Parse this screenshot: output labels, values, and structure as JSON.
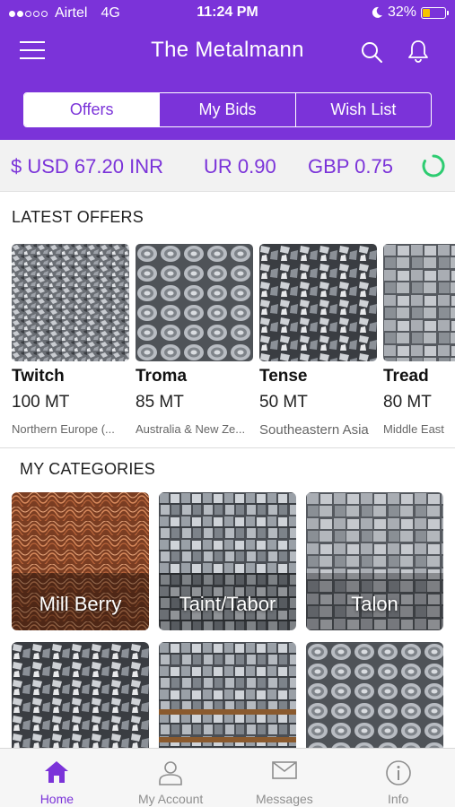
{
  "status_bar": {
    "carrier": "Airtel",
    "network": "4G",
    "time": "11:24 PM",
    "battery": "32%"
  },
  "header": {
    "title": "The Metalmann"
  },
  "tabs": [
    {
      "label": "Offers",
      "active": true
    },
    {
      "label": "My Bids",
      "active": false
    },
    {
      "label": "Wish List",
      "active": false
    }
  ],
  "ticker": [
    {
      "text": "$ USD 67.20 INR"
    },
    {
      "text": "UR 0.90"
    },
    {
      "text": "GBP 0.75"
    }
  ],
  "latest_offers": {
    "title": "LATEST OFFERS",
    "items": [
      {
        "name": "Twitch",
        "quantity": "100 MT",
        "region": "Northern Europe (..."
      },
      {
        "name": "Troma",
        "quantity": "85 MT",
        "region": "Australia & New Ze..."
      },
      {
        "name": "Tense",
        "quantity": "50 MT",
        "region": "Southeastern Asia"
      },
      {
        "name": "Tread",
        "quantity": "80 MT",
        "region": "Middle East"
      }
    ]
  },
  "my_categories": {
    "title": "MY CATEGORIES",
    "items": [
      {
        "label": "Mill Berry"
      },
      {
        "label": "Taint/Tabor"
      },
      {
        "label": "Talon"
      }
    ]
  },
  "tab_bar": [
    {
      "label": "Home",
      "icon": "home-icon",
      "active": true
    },
    {
      "label": "My Account",
      "icon": "account-icon",
      "active": false
    },
    {
      "label": "Messages",
      "icon": "messages-icon",
      "active": false
    },
    {
      "label": "Info",
      "icon": "info-icon",
      "active": false
    }
  ],
  "colors": {
    "brand": "#7b33d9",
    "spinner": "#2ecc71"
  }
}
